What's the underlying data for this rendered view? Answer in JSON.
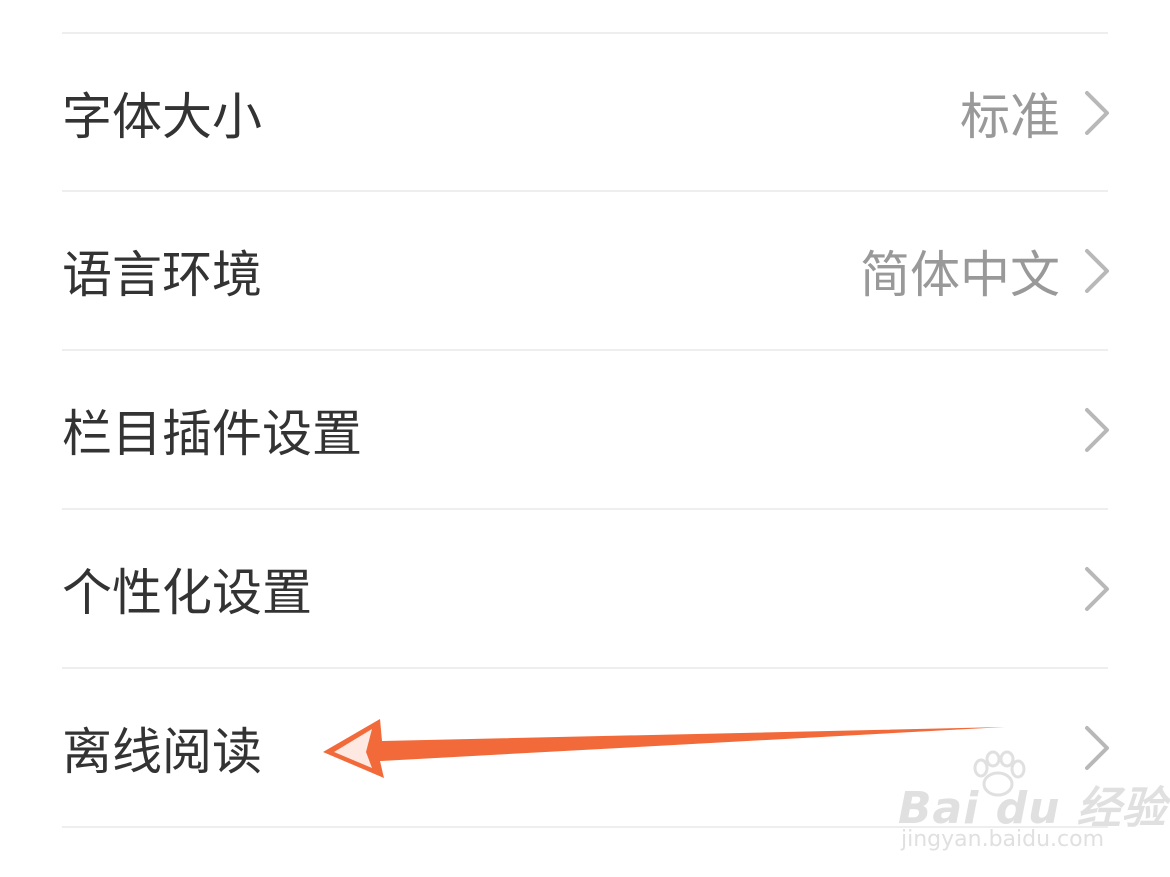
{
  "settings": {
    "rows": [
      {
        "label": "字体大小",
        "value": "标准"
      },
      {
        "label": "语言环境",
        "value": "简体中文"
      },
      {
        "label": "栏目插件设置",
        "value": ""
      },
      {
        "label": "个性化设置",
        "value": ""
      },
      {
        "label": "离线阅读",
        "value": ""
      }
    ]
  },
  "annotation": {
    "arrow_color": "#f26a3a",
    "points_to": "离线阅读"
  },
  "watermark": {
    "logo": "Bai du 经验",
    "url": "jingyan.baidu.com"
  },
  "icons": {
    "chevron": "chevron-right-icon",
    "watermark_logo": "baidu-paw-icon"
  }
}
